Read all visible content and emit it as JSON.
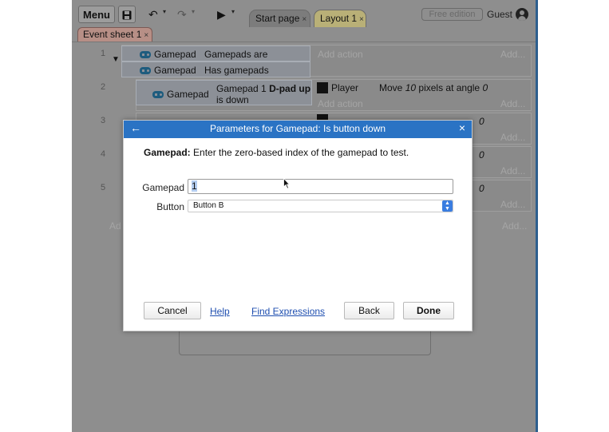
{
  "toolbar": {
    "menu_label": "Menu",
    "save_icon": "floppy-disk-icon",
    "tabs": [
      {
        "label": "Start page",
        "close": "×"
      },
      {
        "label": "Layout 1",
        "close": "×"
      }
    ],
    "edition_label": "Free edition",
    "user_label": "Guest"
  },
  "sheet_tab": {
    "label": "Event sheet 1",
    "close": "×"
  },
  "events": {
    "row_numbers": [
      "1",
      "2",
      "3",
      "4",
      "5"
    ],
    "e1": {
      "conditions": [
        {
          "object": "Gamepad",
          "text": "Gamepads are supported"
        },
        {
          "object": "Gamepad",
          "text": "Has gamepads"
        }
      ],
      "add_action": "Add action",
      "add_more": "Add..."
    },
    "e2": {
      "condition_object": "Gamepad",
      "condition_text_1": "Gamepad 1",
      "condition_text_bold": "D-pad up",
      "condition_text_2": "is down",
      "action_object": "Player",
      "action_text_1": "Move",
      "action_text_num": "10",
      "action_text_2": "pixels at angle",
      "action_text_angle": "0",
      "add_action": "Add action",
      "add_more": "Add..."
    },
    "angle_values": [
      "0",
      "0",
      "0"
    ],
    "add_more_rows": [
      "Add...",
      "Add...",
      "Add..."
    ],
    "add_left": "Ad",
    "add_right": "Add..."
  },
  "dialog": {
    "title": "Parameters for Gamepad: Is button down",
    "description_bold": "Gamepad:",
    "description": "Enter the zero-based index of the gamepad to test.",
    "gamepad_label": "Gamepad",
    "gamepad_value": "1",
    "button_label": "Button",
    "button_value": "Button B",
    "cancel_label": "Cancel",
    "help_label": "Help",
    "find_label": "Find Expressions",
    "back_label": "Back",
    "done_label": "Done"
  },
  "colors": {
    "dialog_header": "#2a73c4",
    "selection": "#b4cdf0",
    "link": "#1f4fb0",
    "layout_tab": "#b9b077",
    "sheet_tab": "#b78f86"
  }
}
